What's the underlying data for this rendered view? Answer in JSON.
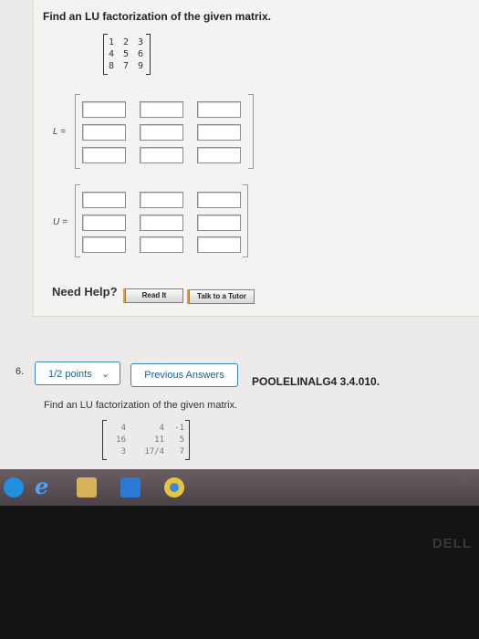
{
  "question5": {
    "prompt": "Find an LU factorization of the given matrix.",
    "matrix": [
      [
        "1",
        "2",
        "3"
      ],
      [
        "4",
        "5",
        "6"
      ],
      [
        "8",
        "7",
        "9"
      ]
    ],
    "l_label": "L =",
    "u_label": "U ="
  },
  "help": {
    "label": "Need Help?",
    "read_it": "Read It",
    "talk_to_tutor": "Talk to a Tutor"
  },
  "question6": {
    "number": "6.",
    "points": "1/2 points",
    "previous_answers": "Previous Answers",
    "code": "POOLELINALG4 3.4.010.",
    "prompt": "Find an LU factorization of the given matrix.",
    "matrix": [
      [
        "4",
        "4",
        "-1"
      ],
      [
        "16",
        "11",
        "5"
      ],
      [
        "3",
        "17/4",
        "7"
      ]
    ]
  },
  "taskbar": {
    "icons": [
      "windows-start-icon",
      "internet-explorer-icon",
      "file-explorer-icon",
      "windows-store-icon",
      "chrome-icon"
    ]
  },
  "bezel": {
    "brand": "DELL"
  },
  "colors": {
    "accent": "#3a86b5",
    "help_accent": "#e89a2a"
  }
}
